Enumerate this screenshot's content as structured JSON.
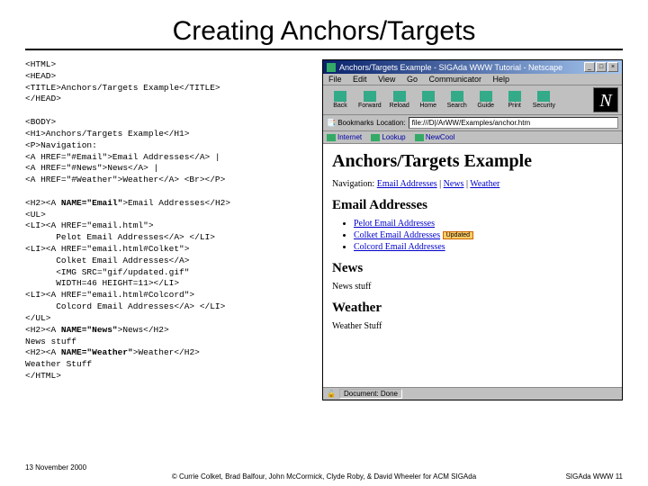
{
  "slide": {
    "title": "Creating Anchors/Targets",
    "date": "13 November 2000",
    "pageref": "SIGAda WWW 11",
    "copyright": "© Currie Colket, Brad Balfour, John McCormick, Clyde Roby, & David Wheeler for ACM SIGAda"
  },
  "code": {
    "l01": "<HTML>",
    "l02": "<HEAD>",
    "l03": "<TITLE>Anchors/Targets Example</TITLE>",
    "l04": "</HEAD>",
    "l05": "",
    "l06": "<BODY>",
    "l07": "<H1>Anchors/Targets Example</H1>",
    "l08": "<P>Navigation:",
    "l09": "<A HREF=\"#Email\">Email Addresses</A> |",
    "l10": "<A HREF=\"#News\">News</A> |",
    "l11": "<A HREF=\"#Weather\">Weather</A> <Br></P>",
    "l12": "",
    "l13a": "<H2><A ",
    "l13b": "NAME=\"Email\"",
    "l13c": ">Email Addresses</H2>",
    "l14": "<UL>",
    "l15": "<LI><A HREF=\"email.html\">",
    "l16": "      Pelot Email Addresses</A> </LI>",
    "l17": "<LI><A HREF=\"email.html#Colket\">",
    "l18": "      Colket Email Addresses</A>",
    "l19": "      <IMG SRC=\"gif/updated.gif\"",
    "l20": "      WIDTH=46 HEIGHT=11></LI>",
    "l21": "<LI><A HREF=\"email.html#Colcord\">",
    "l22": "      Colcord Email Addresses</A> </LI>",
    "l23": "</UL>",
    "l24a": "<H2><A ",
    "l24b": "NAME=\"News\"",
    "l24c": ">News</H2>",
    "l25": "News stuff",
    "l26a": "<H2><A ",
    "l26b": "NAME=\"Weather\"",
    "l26c": ">Weather</H2>",
    "l27": "Weather Stuff",
    "l28": "</HTML>"
  },
  "browser": {
    "title": "Anchors/Targets Example - SIGAda WWW Tutorial - Netscape",
    "menus": [
      "File",
      "Edit",
      "View",
      "Go",
      "Communicator",
      "Help"
    ],
    "toolbar": [
      {
        "label": "Back",
        "color": "#3a8"
      },
      {
        "label": "Forward",
        "color": "#3a8"
      },
      {
        "label": "Reload",
        "color": "#3a8"
      },
      {
        "label": "Home",
        "color": "#3a8"
      },
      {
        "label": "Search",
        "color": "#3a8"
      },
      {
        "label": "Guide",
        "color": "#3a8"
      },
      {
        "label": "Print",
        "color": "#3a8"
      },
      {
        "label": "Security",
        "color": "#3a8"
      }
    ],
    "bookmarks_label": "Bookmarks",
    "location_label": "Location:",
    "location_value": "file:///D|/ArWW/Examples/anchor.htm",
    "quicklinks": [
      "Internet",
      "Lookup",
      "NewCool"
    ],
    "status": "Document: Done"
  },
  "rendered": {
    "h1": "Anchors/Targets Example",
    "nav_label": "Navigation: ",
    "nav_links": {
      "a": "Email Addresses",
      "b": "News",
      "c": "Weather"
    },
    "sep": " | ",
    "h2_email": "Email Addresses",
    "li1": "Pelot Email Addresses",
    "li2": "Colket Email Addresses",
    "li3": "Colcord Email Addresses",
    "updated": "Updated",
    "h2_news": "News",
    "news_body": "News stuff",
    "h2_weather": "Weather",
    "weather_body": "Weather Stuff"
  }
}
